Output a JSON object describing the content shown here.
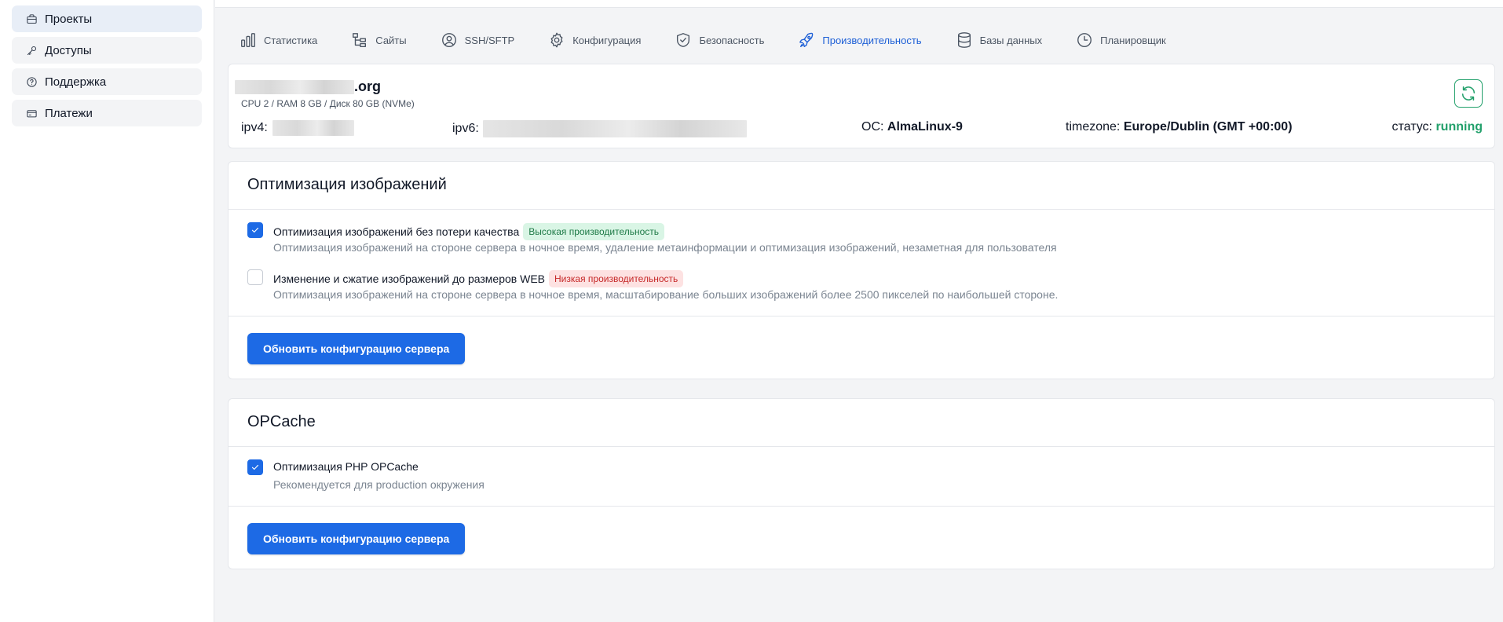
{
  "sidebar": {
    "items": [
      {
        "label": "Проекты",
        "icon": "briefcase-icon",
        "active": true
      },
      {
        "label": "Доступы",
        "icon": "key-icon",
        "active": false
      },
      {
        "label": "Поддержка",
        "icon": "help-circle-icon",
        "active": false
      },
      {
        "label": "Платежи",
        "icon": "credit-card-icon",
        "active": false
      }
    ]
  },
  "tabs": [
    {
      "label": "Статистика",
      "icon": "bar-chart-icon"
    },
    {
      "label": "Сайты",
      "icon": "sitemap-icon"
    },
    {
      "label": "SSH/SFTP",
      "icon": "user-circle-icon"
    },
    {
      "label": "Конфигурация",
      "icon": "gear-icon"
    },
    {
      "label": "Безопасность",
      "icon": "shield-check-icon"
    },
    {
      "label": "Производительность",
      "icon": "rocket-icon",
      "active": true
    },
    {
      "label": "Базы данных",
      "icon": "database-icon"
    },
    {
      "label": "Планировщик",
      "icon": "clock-icon"
    }
  ],
  "server": {
    "domain_suffix": ".org",
    "specs": "CPU 2 / RAM 8 GB / Диск 80 GB (NVMe)",
    "ipv4_label": "ipv4:",
    "ipv6_label": "ipv6:",
    "os_label": "ОС:",
    "os_value": "AlmaLinux-9",
    "timezone_label": "timezone:",
    "timezone_value": "Europe/Dublin (GMT +00:00)",
    "status_label": "статус:",
    "status_value": "running",
    "status_color": "#22a06b"
  },
  "image_opt": {
    "title": "Оптимизация изображений",
    "options": [
      {
        "label": "Оптимизация изображений без потери качества",
        "badge": "Высокая производительность",
        "badge_type": "green",
        "checked": true,
        "description": "Оптимизация изображений на стороне сервера в ночное время, удаление метаинформации и оптимизация изображений, незаметная для пользователя"
      },
      {
        "label": "Изменение и сжатие изображений до размеров WEB",
        "badge": "Низкая производительность",
        "badge_type": "red",
        "checked": false,
        "description": "Оптимизация изображений на стороне сервера в ночное время, масштабирование больших изображений более 2500 пикселей по наибольшей стороне."
      }
    ],
    "button_label": "Обновить конфигурацию сервера"
  },
  "opcache": {
    "title": "OPCache",
    "options": [
      {
        "label": "Оптимизация PHP OPCache",
        "checked": true,
        "description": "Рекомендуется для production окружения"
      }
    ],
    "button_label": "Обновить конфигурацию сервера"
  },
  "colors": {
    "accent": "#1d6ae5",
    "active_tab": "#1d5fd6",
    "success": "#22a06b"
  }
}
